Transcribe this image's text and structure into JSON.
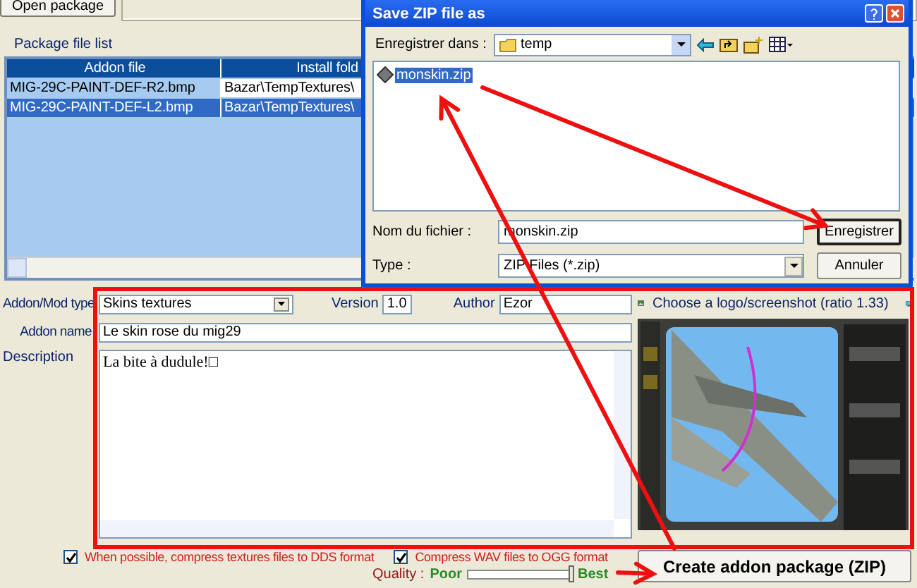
{
  "toolbar": {
    "open_button": "Open package"
  },
  "package_list": {
    "label": "Package file list",
    "columns": [
      "Addon file",
      "Install fold"
    ],
    "rows": [
      {
        "cells": [
          "MIG-29C-PAINT-DEF-R2.bmp",
          "Bazar\\TempTextures\\"
        ],
        "selected": false
      },
      {
        "cells": [
          "MIG-29C-PAINT-DEF-L2.bmp",
          "Bazar\\TempTextures\\"
        ],
        "selected": true
      }
    ]
  },
  "form": {
    "type_label": "Addon/Mod type",
    "type_value": "Skins textures",
    "version_label": "Version",
    "version_value": "1.0",
    "author_label": "Author",
    "author_value": "Ezor",
    "name_label": "Addon name",
    "name_value": "Le skin rose du mig29",
    "description_label": "Description",
    "description_value": "La bite à dudule!□"
  },
  "options": [
    {
      "label": "When possible, compress textures files to DDS format",
      "checked": true
    },
    {
      "label": "Compress WAV files to OGG format",
      "checked": true
    }
  ],
  "quality": {
    "label": "Quality :",
    "low": "Poor",
    "high": "Best",
    "level": 1
  },
  "logo": {
    "label": "Choose a logo/screenshot (ratio 1.33)",
    "kind": "picture"
  },
  "create_button": "Create addon package (ZIP)",
  "dialog": {
    "title": "Save ZIP file as",
    "save_in_label": "Enregistrer dans :",
    "folder": "temp",
    "files": [
      {
        "name": "monskin.zip",
        "selected": true
      }
    ],
    "filename_label": "Nom du fichier :",
    "filename": "monskin.zip",
    "type_label": "Type :",
    "type_value": "ZIP Files (*.zip)",
    "buttons": [
      "Enregistrer",
      "Annuler"
    ]
  }
}
